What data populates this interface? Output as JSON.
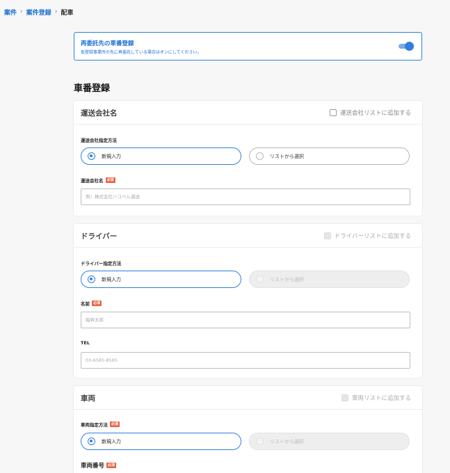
{
  "breadcrumb": {
    "items": [
      "案件",
      "案件登録"
    ],
    "current": "配車"
  },
  "subcontract": {
    "title": "再委託先の車番登録",
    "description": "仮登録事業所の先に再委託している場合はオンにしてください。",
    "toggle_on": true
  },
  "section_title": "車番登録",
  "transport_company": {
    "title": "運送会社名",
    "add_to_list": "運送会社リストに追加する",
    "method_label": "運送会社指定方法",
    "option_new": "新規入力",
    "option_list": "リストから選択",
    "name_label": "運送会社名",
    "required": "必須",
    "name_placeholder": "例）株式会社ハコベル運送",
    "name_value": ""
  },
  "driver": {
    "title": "ドライバー",
    "add_to_list": "ドライバーリストに追加する",
    "method_label": "ドライバー指定方法",
    "option_new": "新規入力",
    "option_list": "リストから選択",
    "name_label": "名前",
    "required": "必須",
    "name_placeholder": "箱幹太郎",
    "name_value": "",
    "tel_label": "TEL",
    "tel_placeholder": "03-6585-8585",
    "tel_value": ""
  },
  "vehicle": {
    "title": "車両",
    "add_to_list": "車両リストに追加する",
    "method_label": "車両指定方法",
    "method_required": "必須",
    "option_new": "新規入力",
    "option_list": "リストから選択",
    "number_label": "車両番号",
    "number_required": "必須"
  },
  "colors": {
    "accent": "#2f7ee0",
    "link": "#1a6fd1",
    "required_badge": "#e8613c",
    "background": "#f7f7f7"
  },
  "icons": {
    "breadcrumb_separator": "chevron-right-icon"
  }
}
